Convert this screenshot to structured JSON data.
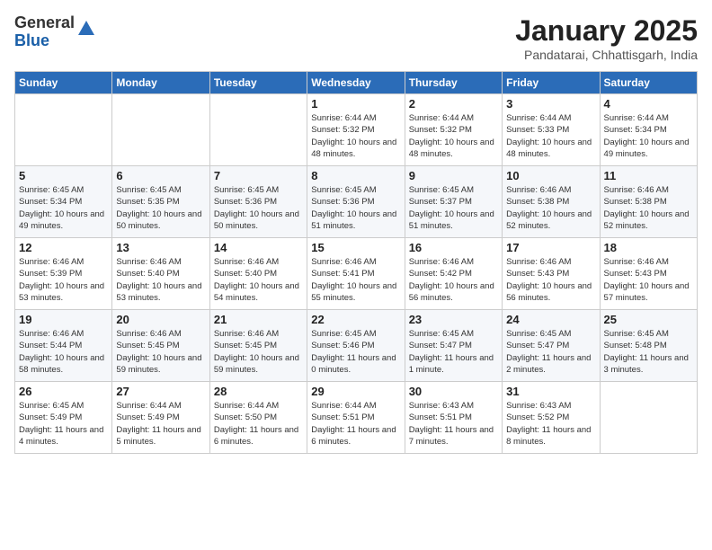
{
  "header": {
    "logo_line1": "General",
    "logo_line2": "Blue",
    "month_title": "January 2025",
    "location": "Pandatarai, Chhattisgarh, India"
  },
  "days_of_week": [
    "Sunday",
    "Monday",
    "Tuesday",
    "Wednesday",
    "Thursday",
    "Friday",
    "Saturday"
  ],
  "weeks": [
    [
      {
        "day": "",
        "sunrise": "",
        "sunset": "",
        "daylight": ""
      },
      {
        "day": "",
        "sunrise": "",
        "sunset": "",
        "daylight": ""
      },
      {
        "day": "",
        "sunrise": "",
        "sunset": "",
        "daylight": ""
      },
      {
        "day": "1",
        "sunrise": "Sunrise: 6:44 AM",
        "sunset": "Sunset: 5:32 PM",
        "daylight": "Daylight: 10 hours and 48 minutes."
      },
      {
        "day": "2",
        "sunrise": "Sunrise: 6:44 AM",
        "sunset": "Sunset: 5:32 PM",
        "daylight": "Daylight: 10 hours and 48 minutes."
      },
      {
        "day": "3",
        "sunrise": "Sunrise: 6:44 AM",
        "sunset": "Sunset: 5:33 PM",
        "daylight": "Daylight: 10 hours and 48 minutes."
      },
      {
        "day": "4",
        "sunrise": "Sunrise: 6:44 AM",
        "sunset": "Sunset: 5:34 PM",
        "daylight": "Daylight: 10 hours and 49 minutes."
      }
    ],
    [
      {
        "day": "5",
        "sunrise": "Sunrise: 6:45 AM",
        "sunset": "Sunset: 5:34 PM",
        "daylight": "Daylight: 10 hours and 49 minutes."
      },
      {
        "day": "6",
        "sunrise": "Sunrise: 6:45 AM",
        "sunset": "Sunset: 5:35 PM",
        "daylight": "Daylight: 10 hours and 50 minutes."
      },
      {
        "day": "7",
        "sunrise": "Sunrise: 6:45 AM",
        "sunset": "Sunset: 5:36 PM",
        "daylight": "Daylight: 10 hours and 50 minutes."
      },
      {
        "day": "8",
        "sunrise": "Sunrise: 6:45 AM",
        "sunset": "Sunset: 5:36 PM",
        "daylight": "Daylight: 10 hours and 51 minutes."
      },
      {
        "day": "9",
        "sunrise": "Sunrise: 6:45 AM",
        "sunset": "Sunset: 5:37 PM",
        "daylight": "Daylight: 10 hours and 51 minutes."
      },
      {
        "day": "10",
        "sunrise": "Sunrise: 6:46 AM",
        "sunset": "Sunset: 5:38 PM",
        "daylight": "Daylight: 10 hours and 52 minutes."
      },
      {
        "day": "11",
        "sunrise": "Sunrise: 6:46 AM",
        "sunset": "Sunset: 5:38 PM",
        "daylight": "Daylight: 10 hours and 52 minutes."
      }
    ],
    [
      {
        "day": "12",
        "sunrise": "Sunrise: 6:46 AM",
        "sunset": "Sunset: 5:39 PM",
        "daylight": "Daylight: 10 hours and 53 minutes."
      },
      {
        "day": "13",
        "sunrise": "Sunrise: 6:46 AM",
        "sunset": "Sunset: 5:40 PM",
        "daylight": "Daylight: 10 hours and 53 minutes."
      },
      {
        "day": "14",
        "sunrise": "Sunrise: 6:46 AM",
        "sunset": "Sunset: 5:40 PM",
        "daylight": "Daylight: 10 hours and 54 minutes."
      },
      {
        "day": "15",
        "sunrise": "Sunrise: 6:46 AM",
        "sunset": "Sunset: 5:41 PM",
        "daylight": "Daylight: 10 hours and 55 minutes."
      },
      {
        "day": "16",
        "sunrise": "Sunrise: 6:46 AM",
        "sunset": "Sunset: 5:42 PM",
        "daylight": "Daylight: 10 hours and 56 minutes."
      },
      {
        "day": "17",
        "sunrise": "Sunrise: 6:46 AM",
        "sunset": "Sunset: 5:43 PM",
        "daylight": "Daylight: 10 hours and 56 minutes."
      },
      {
        "day": "18",
        "sunrise": "Sunrise: 6:46 AM",
        "sunset": "Sunset: 5:43 PM",
        "daylight": "Daylight: 10 hours and 57 minutes."
      }
    ],
    [
      {
        "day": "19",
        "sunrise": "Sunrise: 6:46 AM",
        "sunset": "Sunset: 5:44 PM",
        "daylight": "Daylight: 10 hours and 58 minutes."
      },
      {
        "day": "20",
        "sunrise": "Sunrise: 6:46 AM",
        "sunset": "Sunset: 5:45 PM",
        "daylight": "Daylight: 10 hours and 59 minutes."
      },
      {
        "day": "21",
        "sunrise": "Sunrise: 6:46 AM",
        "sunset": "Sunset: 5:45 PM",
        "daylight": "Daylight: 10 hours and 59 minutes."
      },
      {
        "day": "22",
        "sunrise": "Sunrise: 6:45 AM",
        "sunset": "Sunset: 5:46 PM",
        "daylight": "Daylight: 11 hours and 0 minutes."
      },
      {
        "day": "23",
        "sunrise": "Sunrise: 6:45 AM",
        "sunset": "Sunset: 5:47 PM",
        "daylight": "Daylight: 11 hours and 1 minute."
      },
      {
        "day": "24",
        "sunrise": "Sunrise: 6:45 AM",
        "sunset": "Sunset: 5:47 PM",
        "daylight": "Daylight: 11 hours and 2 minutes."
      },
      {
        "day": "25",
        "sunrise": "Sunrise: 6:45 AM",
        "sunset": "Sunset: 5:48 PM",
        "daylight": "Daylight: 11 hours and 3 minutes."
      }
    ],
    [
      {
        "day": "26",
        "sunrise": "Sunrise: 6:45 AM",
        "sunset": "Sunset: 5:49 PM",
        "daylight": "Daylight: 11 hours and 4 minutes."
      },
      {
        "day": "27",
        "sunrise": "Sunrise: 6:44 AM",
        "sunset": "Sunset: 5:49 PM",
        "daylight": "Daylight: 11 hours and 5 minutes."
      },
      {
        "day": "28",
        "sunrise": "Sunrise: 6:44 AM",
        "sunset": "Sunset: 5:50 PM",
        "daylight": "Daylight: 11 hours and 6 minutes."
      },
      {
        "day": "29",
        "sunrise": "Sunrise: 6:44 AM",
        "sunset": "Sunset: 5:51 PM",
        "daylight": "Daylight: 11 hours and 6 minutes."
      },
      {
        "day": "30",
        "sunrise": "Sunrise: 6:43 AM",
        "sunset": "Sunset: 5:51 PM",
        "daylight": "Daylight: 11 hours and 7 minutes."
      },
      {
        "day": "31",
        "sunrise": "Sunrise: 6:43 AM",
        "sunset": "Sunset: 5:52 PM",
        "daylight": "Daylight: 11 hours and 8 minutes."
      },
      {
        "day": "",
        "sunrise": "",
        "sunset": "",
        "daylight": ""
      }
    ]
  ]
}
